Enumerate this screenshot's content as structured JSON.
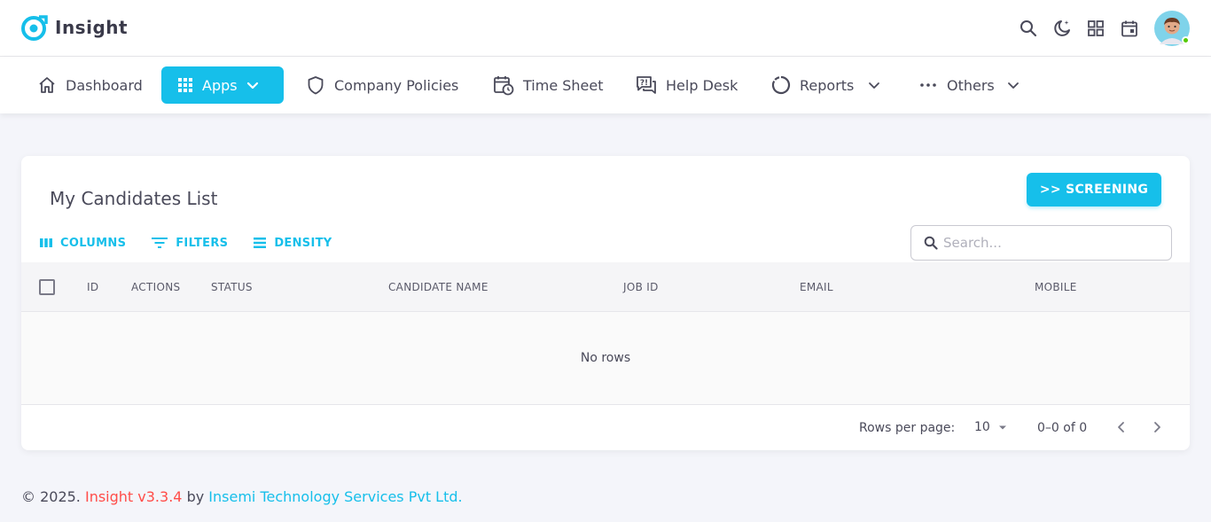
{
  "app": {
    "name": "Insight",
    "brand_color": "#16bfea"
  },
  "nav": {
    "dashboard": "Dashboard",
    "apps": "Apps",
    "company_policies": "Company Policies",
    "time_sheet": "Time Sheet",
    "help_desk": "Help Desk",
    "reports": "Reports",
    "others": "Others"
  },
  "card": {
    "title": "My Candidates List",
    "screening_button": ">> SCREENING",
    "toolbar": {
      "columns": "COLUMNS",
      "filters": "FILTERS",
      "density": "DENSITY"
    },
    "search_placeholder": "Search...",
    "columns": [
      "ID",
      "ACTIONS",
      "STATUS",
      "CANDIDATE NAME",
      "JOB ID",
      "EMAIL",
      "MOBILE"
    ],
    "empty_text": "No rows",
    "pagination": {
      "rows_per_page_label": "Rows per page:",
      "rows_per_page": "10",
      "range": "0–0 of 0"
    }
  },
  "footer": {
    "copyright": "© 2025.",
    "version": "Insight v3.3.4",
    "by": "by",
    "company": "Insemi Technology Services Pvt Ltd."
  },
  "icons": [
    "search-icon",
    "theme-toggle-icon",
    "shortcuts-icon",
    "calendar-icon",
    "home-icon",
    "grid-icon",
    "shield-icon",
    "timesheet-icon",
    "help-desk-icon",
    "reports-icon",
    "more-icon"
  ]
}
